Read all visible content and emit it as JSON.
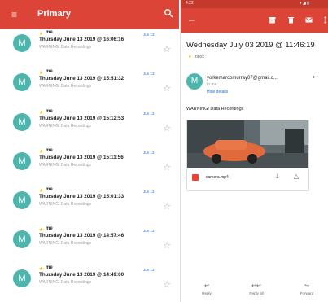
{
  "inbox": {
    "title": "Primary",
    "menu_icon": "menu-icon",
    "search_icon": "search-icon",
    "accent": "#db4437",
    "emails": [
      {
        "avatar": "M",
        "sender": "me",
        "subject": "Thursday June 13 2019 @ 16:06:16",
        "preview": "WARNING! Data Recordings",
        "date": "Jun 13"
      },
      {
        "avatar": "M",
        "sender": "me",
        "subject": "Thursday June 13 2019 @ 15:51:32",
        "preview": "WARNING! Data Recordings",
        "date": "Jun 13"
      },
      {
        "avatar": "M",
        "sender": "me",
        "subject": "Thursday June 13 2019 @ 15:12:53",
        "preview": "WARNING! Data Recordings",
        "date": "Jun 13"
      },
      {
        "avatar": "M",
        "sender": "me",
        "subject": "Thursday June 13 2019 @ 15:11:56",
        "preview": "WARNING! Data Recordings",
        "date": "Jun 13"
      },
      {
        "avatar": "M",
        "sender": "me",
        "subject": "Thursday June 13 2019 @ 15:01:33",
        "preview": "WARNING! Data Recordings",
        "date": "Jun 13"
      },
      {
        "avatar": "M",
        "sender": "me",
        "subject": "Thursday June 13 2019 @ 14:57:46",
        "preview": "WARNING! Data Recordings",
        "date": "Jun 13"
      },
      {
        "avatar": "M",
        "sender": "me",
        "subject": "Thursday June 13 2019 @ 14:49:00",
        "preview": "WARNING! Data Recordings",
        "date": "Jun 13"
      }
    ]
  },
  "message": {
    "status_time": "4:22",
    "status_icons": "▾ ◢ ▮",
    "subject": "Wednesday July 03 2019 @ 11:46:19",
    "label": "Inbox",
    "avatar": "M",
    "from": "yorkemarcomurray07@gmail.c...",
    "to": "to me",
    "details_link": "Hide details",
    "body": "WARNING! Data Recordings",
    "attachment_name": "camera.mp4",
    "actions": [
      {
        "icon": "reply-icon",
        "glyph": "↩",
        "label": "Reply"
      },
      {
        "icon": "reply-all-icon",
        "glyph": "↩↩",
        "label": "Reply all"
      },
      {
        "icon": "forward-icon",
        "glyph": "↪",
        "label": "Forward"
      }
    ]
  }
}
